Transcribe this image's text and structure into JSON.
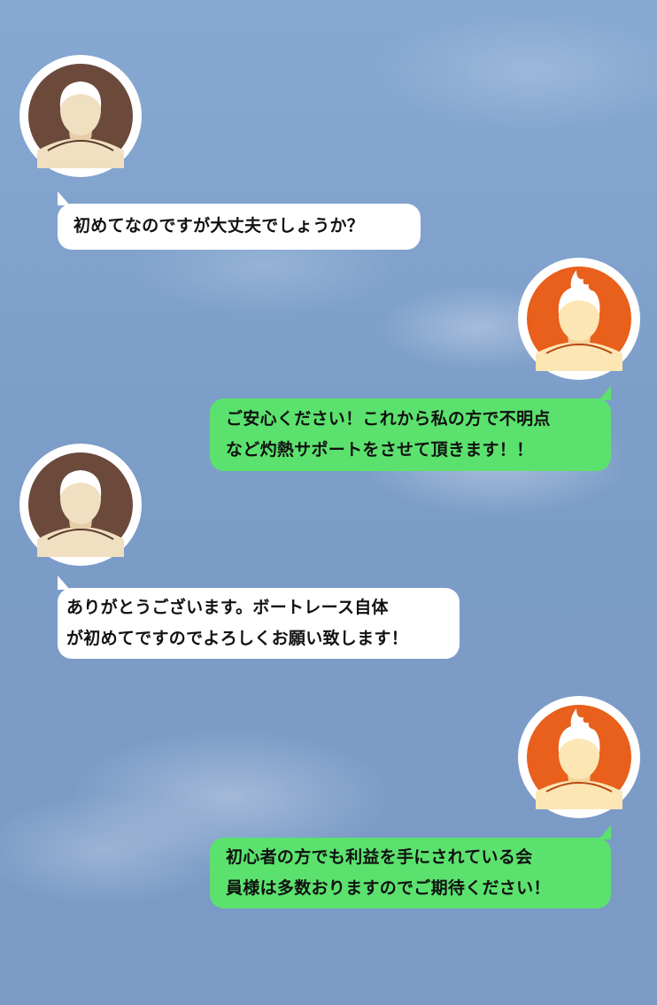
{
  "colors": {
    "user_bubble": "#ffffff",
    "agent_bubble": "#5be26e",
    "user_avatar_bg": "#6b4a3c",
    "agent_avatar_bg": "#e8601b",
    "sky": "#7c9dc8"
  },
  "messages": [
    {
      "sender": "user",
      "icon": "user-avatar-icon",
      "lines": [
        "初めてなのですが大丈夫でしょうか？"
      ]
    },
    {
      "sender": "agent",
      "icon": "agent-avatar-icon",
      "lines": [
        "ご安心ください！これから私の方で不明点",
        "など灼熱サポートをさせて頂きます！！"
      ]
    },
    {
      "sender": "user",
      "icon": "user-avatar-icon",
      "lines": [
        "ありがとうございます。ボートレース自体",
        "が初めてですのでよろしくお願い致します！"
      ]
    },
    {
      "sender": "agent",
      "icon": "agent-avatar-icon",
      "lines": [
        "初心者の方でも利益を手にされている会",
        "員様は多数おりますのでご期待ください！"
      ]
    }
  ]
}
